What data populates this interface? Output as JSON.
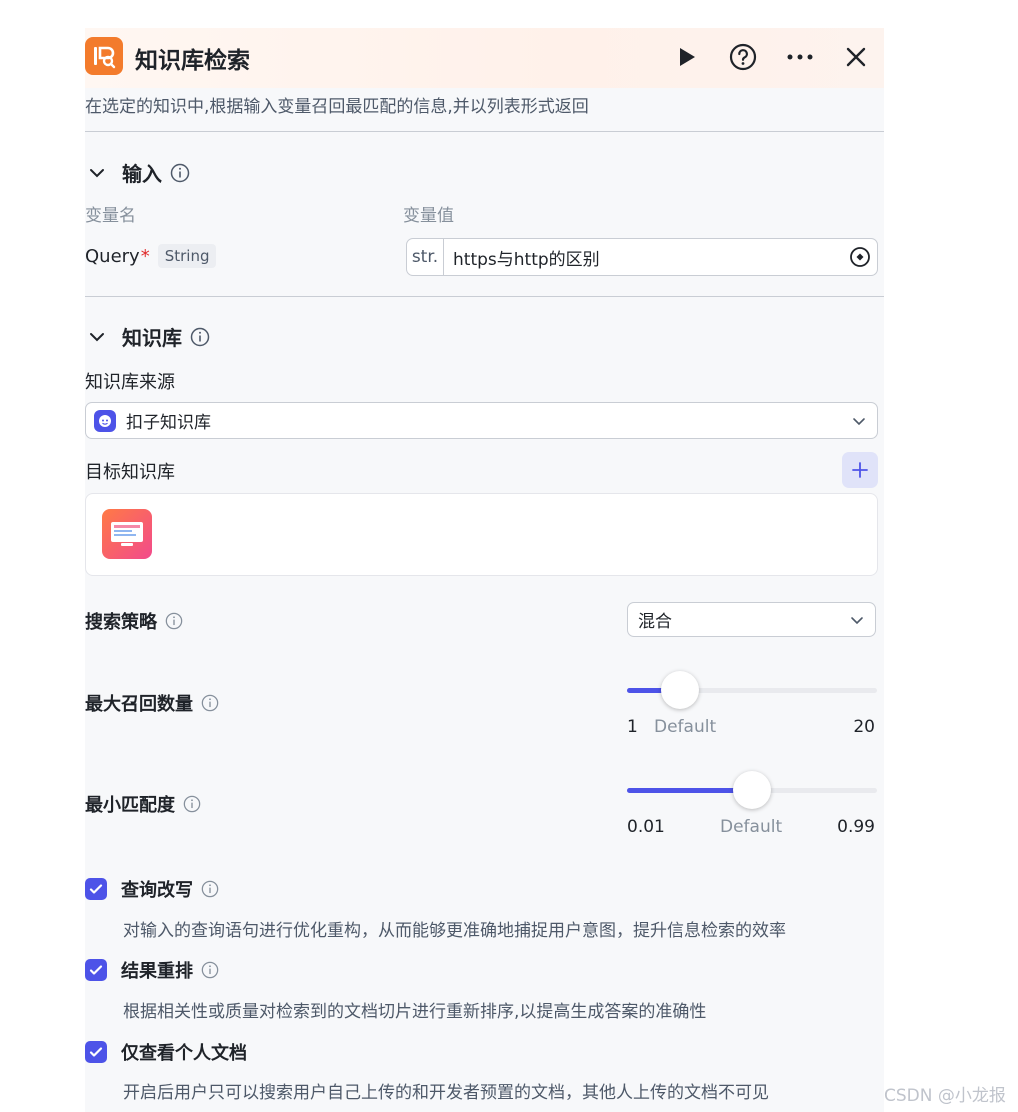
{
  "header": {
    "title": "知识库检索",
    "description": "在选定的知识中,根据输入变量召回最匹配的信息,并以列表形式返回",
    "icons": [
      "knowledge-logo-icon",
      "play-icon",
      "help-icon",
      "more-icon",
      "close-icon"
    ]
  },
  "input_section": {
    "title": "输入",
    "col_name": "变量名",
    "col_value": "变量值",
    "query": {
      "name": "Query",
      "required_mark": "*",
      "type": "String",
      "prefix": "str.",
      "value": "https与http的区别"
    }
  },
  "kb_section": {
    "title": "知识库",
    "source_label": "知识库来源",
    "source_value": "扣子知识库",
    "target_label": "目标知识库"
  },
  "search": {
    "strategy_label": "搜索策略",
    "strategy_value": "混合",
    "max_recall": {
      "label": "最大召回数量",
      "min": "1",
      "default_label": "Default",
      "max": "20",
      "value": 5
    },
    "min_match": {
      "label": "最小匹配度",
      "min": "0.01",
      "default_label": "Default",
      "max": "0.99",
      "value": 0.5
    }
  },
  "options": [
    {
      "label": "查询改写",
      "checked": true,
      "description": "对输入的查询语句进行优化重构，从而能够更准确地捕捉用户意图，提升信息检索的效率"
    },
    {
      "label": "结果重排",
      "checked": true,
      "description": "根据相关性或质量对检索到的文档切片进行重新排序,以提高生成答案的准确性"
    },
    {
      "label": "仅查看个人文档",
      "checked": true,
      "description": "开启后用户只可以搜索用户自己上传的和开发者预置的文档，其他人上传的文档不可见"
    }
  ],
  "watermark": "CSDN @小龙报",
  "colors": {
    "accent": "#4d53e8",
    "brand_orange": "#f37b2c",
    "required": "#e02b2b"
  }
}
